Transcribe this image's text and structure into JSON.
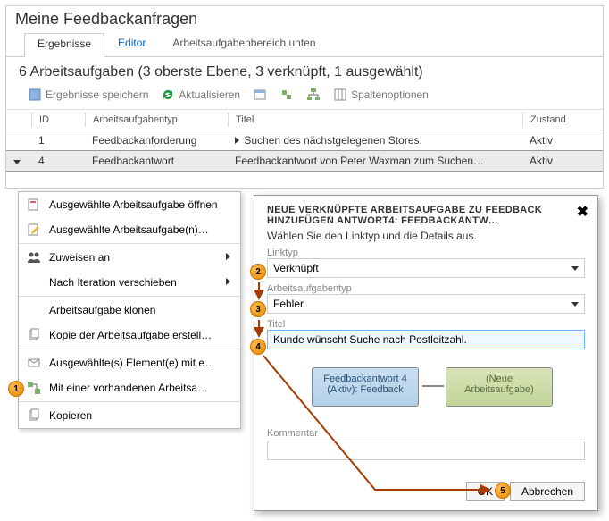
{
  "header": {
    "title": "Meine Feedbackanfragen",
    "tabs": {
      "results": "Ergebnisse",
      "editor": "Editor",
      "area": "Arbeitsaufgabenbereich unten"
    }
  },
  "subtitle": "6 Arbeitsaufgaben (3 oberste Ebene, 3 verknüpft, 1 ausgewählt)",
  "toolbar": {
    "save": "Ergebnisse speichern",
    "refresh": "Aktualisieren",
    "columns": "Spaltenoptionen"
  },
  "columns": {
    "id": "ID",
    "type": "Arbeitsaufgabentyp",
    "title": "Titel",
    "state": "Zustand"
  },
  "rows": [
    {
      "id": "1",
      "type": "Feedbackanforderung",
      "title": "Suchen des nächstgelegenen Stores.",
      "state": "Aktiv"
    },
    {
      "id": "4",
      "type": "Feedbackantwort",
      "title": "Feedbackantwort von Peter Waxman zum Suchen…",
      "state": "Aktiv"
    }
  ],
  "menu": {
    "open": "Ausgewählte Arbeitsaufgabe öffnen",
    "edit": "Ausgewählte Arbeitsaufgabe(n)…",
    "assign": "Zuweisen an",
    "move": "Nach Iteration verschieben",
    "clone": "Arbeitsaufgabe klonen",
    "copywi": "Kopie der Arbeitsaufgabe erstell…",
    "export": "Ausgewählte(s) Element(e) mit e…",
    "linkwi": "Mit einer vorhandenen Arbeitsa…",
    "copy": "Kopieren"
  },
  "dialog": {
    "title": "NEUE VERKNÜPFTE ARBEITSAUFGABE ZU FEEDBACK HINZUFÜGEN ANTWORT4: FEEDBACKANTW…",
    "subtitle": "Wählen Sie den Linktyp und die Details aus.",
    "linktype_label": "Linktyp",
    "linktype_value": "Verknüpft",
    "witype_label": "Arbeitsaufgabentyp",
    "witype_value": "Fehler",
    "title_label": "Titel",
    "title_value": "Kunde wünscht Suche nach Postleitzahl.",
    "node_left": "Feedbackantwort 4 (Aktiv): Feedback",
    "node_right": "(Neue Arbeitsaufgabe)",
    "comment_label": "Kommentar",
    "ok": "OK",
    "cancel": "Abbrechen"
  },
  "steps": {
    "s1": "1",
    "s2": "2",
    "s3": "3",
    "s4": "4",
    "s5": "5"
  }
}
